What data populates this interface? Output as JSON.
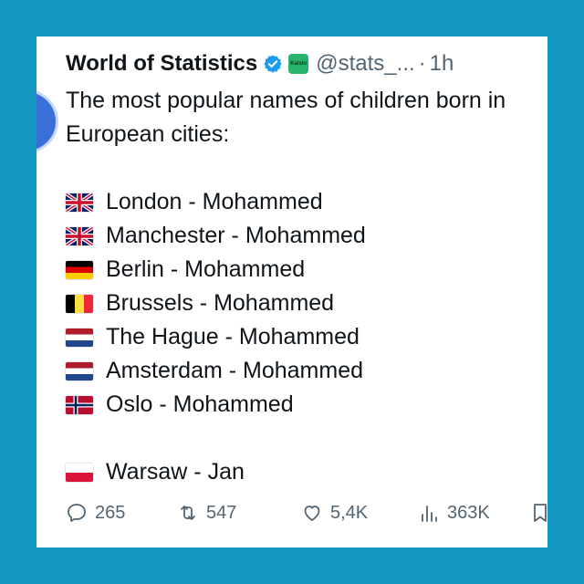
{
  "tweet": {
    "author_name": "World of Statistics",
    "handle": "@stats_...",
    "separator": "·",
    "time": "1h",
    "badge_text": "Kalshi",
    "line1": "The most popular names of children born in",
    "line2": "European cities:",
    "entries": [
      {
        "flag": "uk-flag-icon",
        "text": "London - Mohammed"
      },
      {
        "flag": "uk-flag-icon",
        "text": "Manchester - Mohammed"
      },
      {
        "flag": "germany-flag-icon",
        "text": "Berlin - Mohammed"
      },
      {
        "flag": "belgium-flag-icon",
        "text": "Brussels - Mohammed"
      },
      {
        "flag": "netherlands-flag-icon",
        "text": "The Hague - Mohammed"
      },
      {
        "flag": "netherlands-flag-icon",
        "text": "Amsterdam - Mohammed"
      },
      {
        "flag": "norway-flag-icon",
        "text": "Oslo - Mohammed"
      }
    ],
    "last_entry": {
      "flag": "poland-flag-icon",
      "text": "Warsaw - Jan"
    }
  },
  "actions": {
    "replies": "265",
    "reposts": "547",
    "likes": "5,4K",
    "views": "363K"
  },
  "colors": {
    "background": "#1497c1",
    "verified": "#1d9bf0",
    "secondary_text": "#536471"
  }
}
